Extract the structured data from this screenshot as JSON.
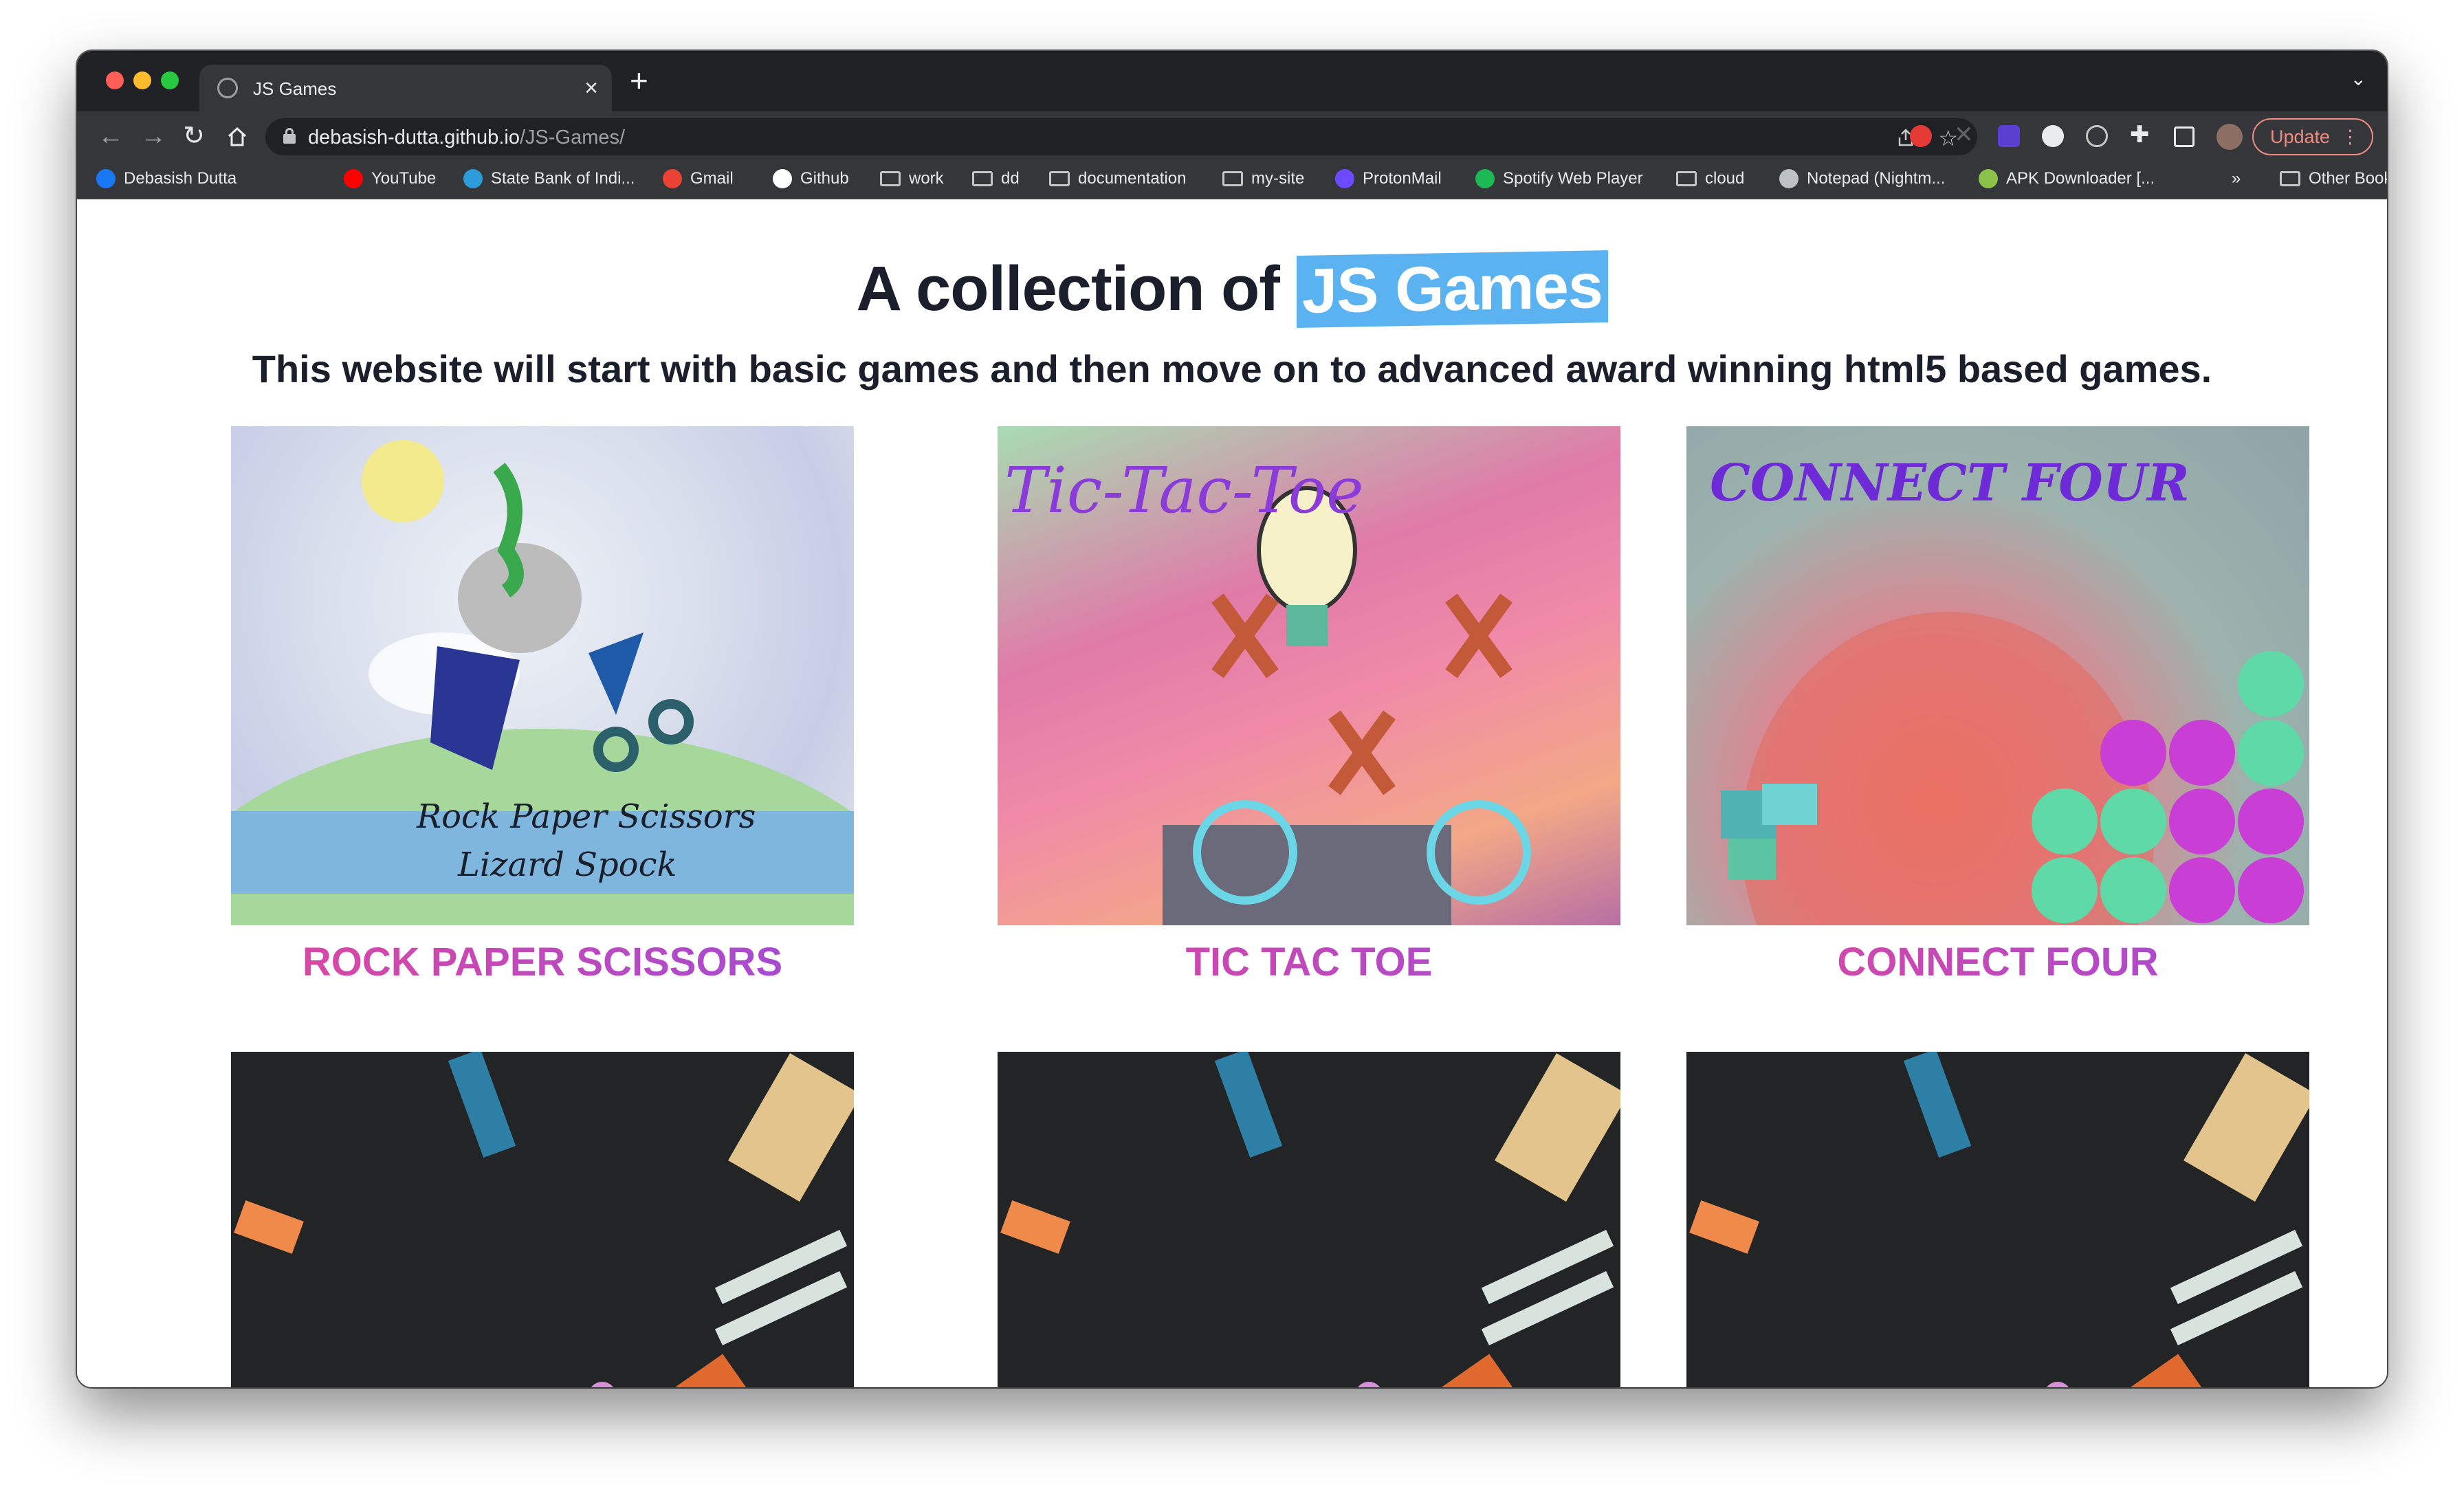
{
  "browser": {
    "tab_title": "JS Games",
    "tab_close": "×",
    "new_tab": "+",
    "tab_menu": "⌄",
    "url_host": "debasish-dutta.github.io",
    "url_path": "/JS-Games/",
    "update_label": "Update",
    "update_dots": "⋮"
  },
  "bookmarks": [
    {
      "label": "Debasish Dutta",
      "icon": "facebook-icon",
      "color": "#1877f2"
    },
    {
      "label": "YouTube",
      "icon": "youtube-icon",
      "color": "#ff0000"
    },
    {
      "label": "State Bank of Indi...",
      "icon": "sbi-icon",
      "color": "#2d9cdb"
    },
    {
      "label": "Gmail",
      "icon": "gmail-icon",
      "color": "#ea4335"
    },
    {
      "label": "Github",
      "icon": "github-icon",
      "color": "#ffffff"
    },
    {
      "label": "work",
      "icon": "folder-icon"
    },
    {
      "label": "dd",
      "icon": "folder-icon"
    },
    {
      "label": "documentation",
      "icon": "folder-icon"
    },
    {
      "label": "my-site",
      "icon": "folder-icon"
    },
    {
      "label": "ProtonMail",
      "icon": "protonmail-icon",
      "color": "#6d4aff"
    },
    {
      "label": "Spotify Web Player",
      "icon": "spotify-icon",
      "color": "#1db954"
    },
    {
      "label": "cloud",
      "icon": "folder-icon"
    },
    {
      "label": "Notepad (Nightm...",
      "icon": "notepad-icon",
      "color": "#bdc1c6"
    },
    {
      "label": "APK Downloader [...",
      "icon": "apk-icon",
      "color": "#8bc34a"
    },
    {
      "label": "»",
      "icon": "overflow-icon"
    },
    {
      "label": "Other Bookmarks",
      "icon": "folder-icon"
    }
  ],
  "main": {
    "title_prefix": "A collection of ",
    "title_highlight": "JS Games",
    "subtitle": "This website will start with basic games and then move on to advanced award winning html5 based games.",
    "games": [
      {
        "title": "ROCK PAPER SCISSORS",
        "art_text_1": "Rock Paper Scissors",
        "art_text_2": "Lizard Spock"
      },
      {
        "title": "TIC TAC TOE",
        "art_text_1": "Tic-Tac-Toe"
      },
      {
        "title": "CONNECT FOUR",
        "art_text_1": "CONNECT FOUR"
      }
    ]
  },
  "colors": {
    "highlight": "#5ab2f0",
    "title_gradient_start": "#e0479e",
    "title_gradient_end": "#a04bd8",
    "text_dark": "#1b1e2b"
  }
}
